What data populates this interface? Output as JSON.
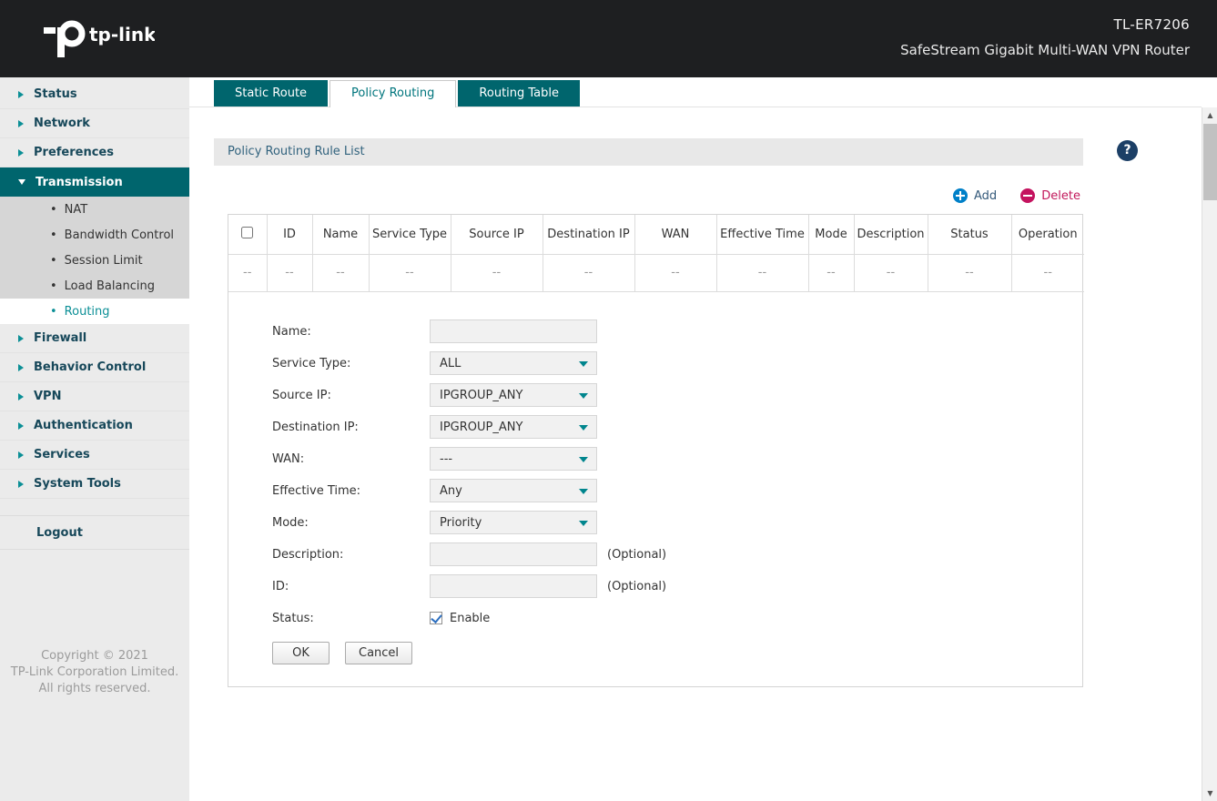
{
  "header": {
    "logo": "tp-link",
    "model": "TL-ER7206",
    "subtitle": "SafeStream Gigabit Multi-WAN VPN Router"
  },
  "sidebar": {
    "items": [
      {
        "label": "Status"
      },
      {
        "label": "Network"
      },
      {
        "label": "Preferences"
      },
      {
        "label": "Transmission"
      },
      {
        "label": "Firewall"
      },
      {
        "label": "Behavior Control"
      },
      {
        "label": "VPN"
      },
      {
        "label": "Authentication"
      },
      {
        "label": "Services"
      },
      {
        "label": "System Tools"
      }
    ],
    "submenu": [
      {
        "label": "NAT"
      },
      {
        "label": "Bandwidth Control"
      },
      {
        "label": "Session Limit"
      },
      {
        "label": "Load Balancing"
      },
      {
        "label": "Routing"
      }
    ],
    "active_submenu": "Routing",
    "logout": "Logout",
    "copyright_line1": "Copyright © 2021",
    "copyright_line2": "TP-Link Corporation Limited.",
    "copyright_line3": "All rights reserved."
  },
  "tabs": [
    {
      "label": "Static Route",
      "active": false
    },
    {
      "label": "Policy Routing",
      "active": true
    },
    {
      "label": "Routing Table",
      "active": false
    }
  ],
  "section": {
    "title": "Policy Routing Rule List",
    "help_glyph": "?"
  },
  "toolbar": {
    "add": "Add",
    "delete": "Delete"
  },
  "table": {
    "columns": [
      "ID",
      "Name",
      "Service Type",
      "Source IP",
      "Destination IP",
      "WAN",
      "Effective Time",
      "Mode",
      "Description",
      "Status",
      "Operation"
    ],
    "empty": [
      "--",
      "--",
      "--",
      "--",
      "--",
      "--",
      "--",
      "--",
      "--",
      "--",
      "--",
      "--"
    ]
  },
  "form": {
    "name_label": "Name:",
    "name_value": "",
    "service_type_label": "Service Type:",
    "service_type_value": "ALL",
    "source_ip_label": "Source IP:",
    "source_ip_value": "IPGROUP_ANY",
    "destination_ip_label": "Destination IP:",
    "destination_ip_value": "IPGROUP_ANY",
    "wan_label": "WAN:",
    "wan_value": "---",
    "effective_time_label": "Effective Time:",
    "effective_time_value": "Any",
    "mode_label": "Mode:",
    "mode_value": "Priority",
    "description_label": "Description:",
    "description_value": "",
    "description_note": "(Optional)",
    "id_label": "ID:",
    "id_value": "",
    "id_note": "(Optional)",
    "status_label": "Status:",
    "status_enable": "Enable",
    "status_checked": true,
    "ok": "OK",
    "cancel": "Cancel"
  },
  "colors": {
    "header_bg": "#1e1f21",
    "teal_accent": "#00656d",
    "active_tab_text": "#00757d",
    "add_icon": "#0080c8",
    "delete_icon": "#c4135f",
    "delete_text": "#c2185b",
    "help_icon_bg": "#1c3f66"
  }
}
